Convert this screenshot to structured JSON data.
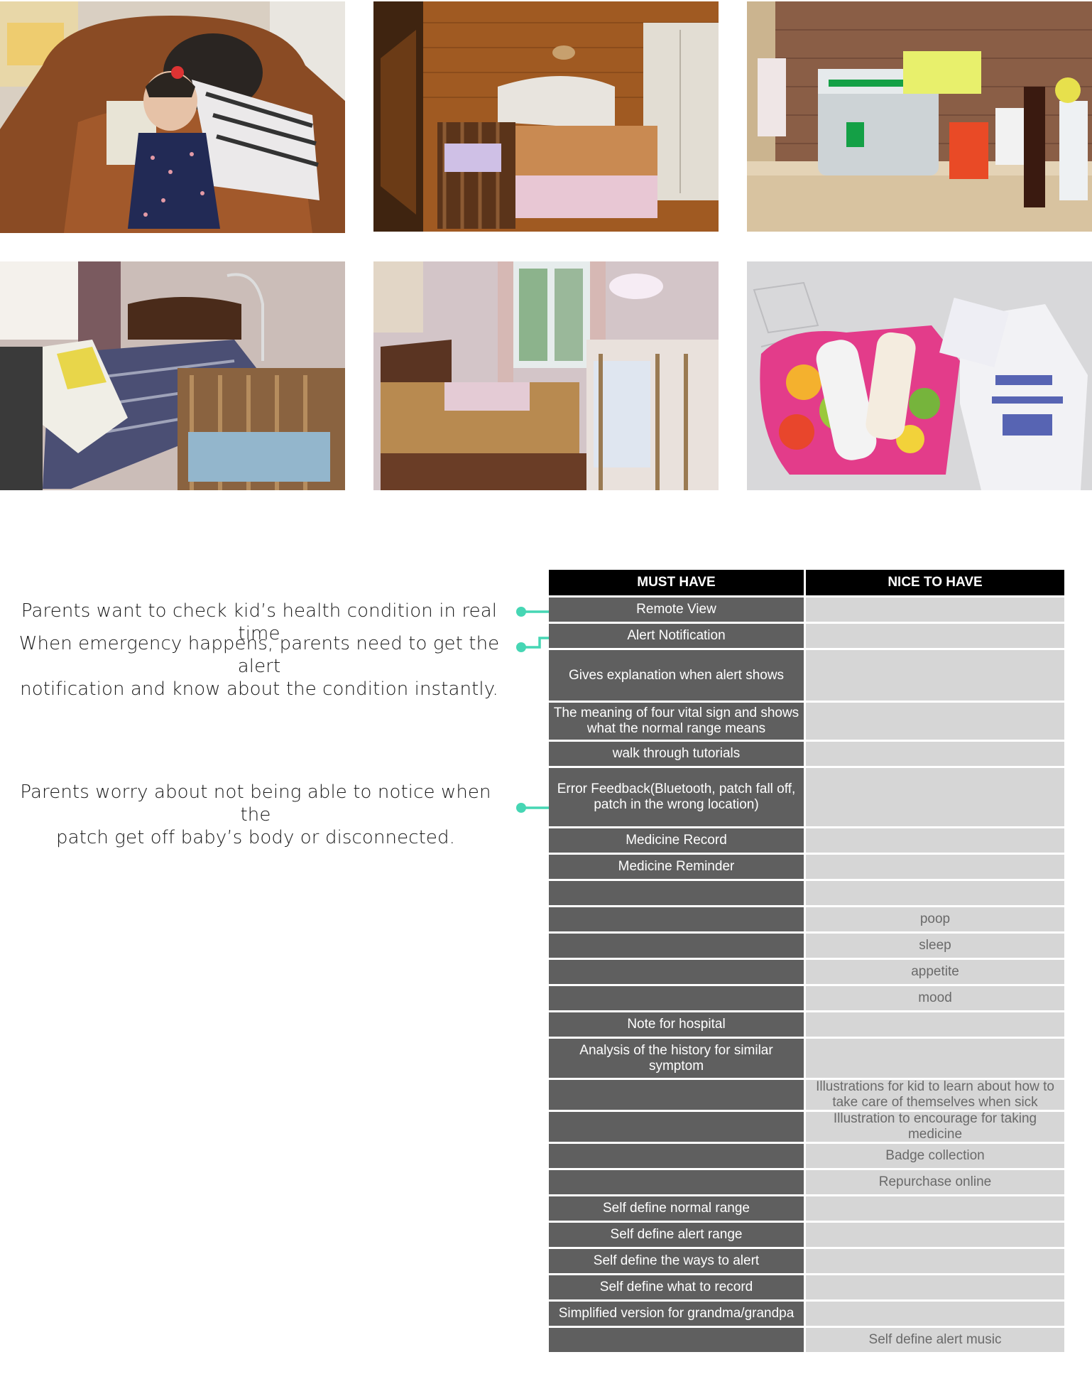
{
  "photos": [
    {
      "label": "Child with parent on leather sofa"
    },
    {
      "label": "Bedroom with crib and wooden wall"
    },
    {
      "label": "Medicine box on shelf"
    },
    {
      "label": "Bedroom with crib and diaper"
    },
    {
      "label": "Bedroom with crib by window"
    },
    {
      "label": "Pouch with thermometer and medicine"
    }
  ],
  "notes": {
    "note1": "Parents want to check kid’s health condition in real time",
    "note2_line1": "When emergency happens, parents need to get the alert",
    "note2_line2": "notification and know about the condition instantly.",
    "note3_line1": "Parents worry about not being able to notice when the",
    "note3_line2": "patch get off baby’s body or disconnected."
  },
  "table": {
    "header_must": "MUST HAVE",
    "header_nice": "NICE TO HAVE",
    "rows": [
      {
        "must": "Remote View",
        "nice": ""
      },
      {
        "must": "Alert Notification",
        "nice": ""
      },
      {
        "must": "Gives explanation when alert shows",
        "nice": ""
      },
      {
        "must": "The meaning of four vital sign and shows what the normal range means",
        "nice": ""
      },
      {
        "must": "walk through tutorials",
        "nice": ""
      },
      {
        "must": "Error Feedback(Bluetooth, patch fall off, patch in the wrong location)",
        "nice": ""
      },
      {
        "must": "Medicine Record",
        "nice": ""
      },
      {
        "must": "Medicine Reminder",
        "nice": ""
      },
      {
        "must": "",
        "nice": ""
      },
      {
        "must": "",
        "nice": "poop"
      },
      {
        "must": "",
        "nice": "sleep"
      },
      {
        "must": "",
        "nice": "appetite"
      },
      {
        "must": "",
        "nice": "mood"
      },
      {
        "must": "Note for hospital",
        "nice": ""
      },
      {
        "must": "Analysis of the history for similar symptom",
        "nice": ""
      },
      {
        "must": "",
        "nice": "Illustrations for kid to learn about how to take care of themselves when sick"
      },
      {
        "must": "",
        "nice": "Illustration to encourage for taking medicine"
      },
      {
        "must": "",
        "nice": "Badge collection"
      },
      {
        "must": "",
        "nice": "Repurchase online"
      },
      {
        "must": "Self define normal range",
        "nice": ""
      },
      {
        "must": "Self define alert range",
        "nice": ""
      },
      {
        "must": "Self define the ways to alert",
        "nice": ""
      },
      {
        "must": "Self define what to record",
        "nice": ""
      },
      {
        "must": "Simplified version for grandma/grandpa",
        "nice": ""
      },
      {
        "must": "",
        "nice": "Self define alert music"
      }
    ]
  },
  "colors": {
    "connector": "#46d6b4",
    "must_cell": "#5f5f5f",
    "nice_cell": "#d6d6d6",
    "header": "#000000"
  }
}
